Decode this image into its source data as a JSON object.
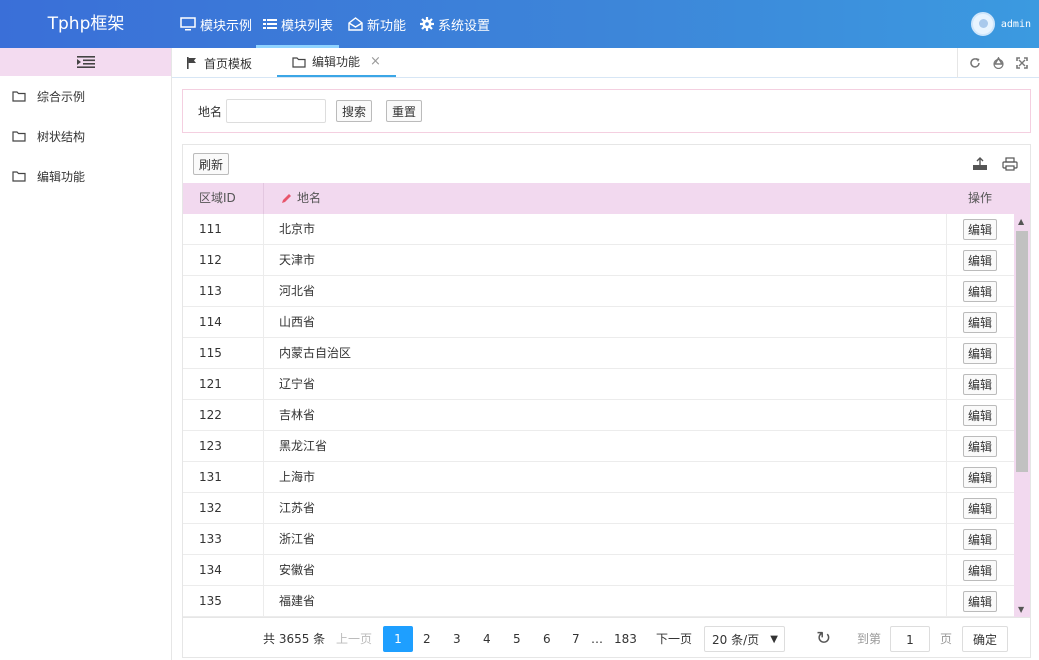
{
  "header": {
    "logo": "Tphp框架",
    "nav": [
      {
        "label": "模块示例",
        "icon": "monitor-icon"
      },
      {
        "label": "模块列表",
        "icon": "list-icon"
      },
      {
        "label": "新功能",
        "icon": "envelope-open-icon"
      },
      {
        "label": "系统设置",
        "icon": "gear-icon"
      }
    ],
    "user": "admin"
  },
  "sidebar": {
    "items": [
      {
        "label": "综合示例",
        "icon": "folder-icon"
      },
      {
        "label": "树状结构",
        "icon": "folder-icon"
      },
      {
        "label": "编辑功能",
        "icon": "folder-icon"
      }
    ]
  },
  "tabs": [
    {
      "label": "首页模板",
      "icon": "flag-icon"
    },
    {
      "label": "编辑功能",
      "icon": "folder-icon",
      "close": "×"
    }
  ],
  "search": {
    "label": "地名",
    "value": "",
    "search_btn": "搜索",
    "reset_btn": "重置"
  },
  "table": {
    "refresh_btn": "刷新",
    "headers": {
      "id": "区域ID",
      "name": "地名",
      "op": "操作"
    },
    "edit_label": "编辑",
    "rows": [
      {
        "id": "111",
        "name": "北京市"
      },
      {
        "id": "112",
        "name": "天津市"
      },
      {
        "id": "113",
        "name": "河北省"
      },
      {
        "id": "114",
        "name": "山西省"
      },
      {
        "id": "115",
        "name": "内蒙古自治区"
      },
      {
        "id": "121",
        "name": "辽宁省"
      },
      {
        "id": "122",
        "name": "吉林省"
      },
      {
        "id": "123",
        "name": "黑龙江省"
      },
      {
        "id": "131",
        "name": "上海市"
      },
      {
        "id": "132",
        "name": "江苏省"
      },
      {
        "id": "133",
        "name": "浙江省"
      },
      {
        "id": "134",
        "name": "安徽省"
      },
      {
        "id": "135",
        "name": "福建省"
      }
    ]
  },
  "pager": {
    "total": "共 3655 条",
    "prev": "上一页",
    "pages": [
      "1",
      "2",
      "3",
      "4",
      "5",
      "6",
      "7"
    ],
    "ellipsis": "…",
    "last": "183",
    "next": "下一页",
    "page_size": "20 条/页",
    "goto": "到第",
    "page_input": "1",
    "page_unit": "页",
    "confirm": "确定"
  }
}
